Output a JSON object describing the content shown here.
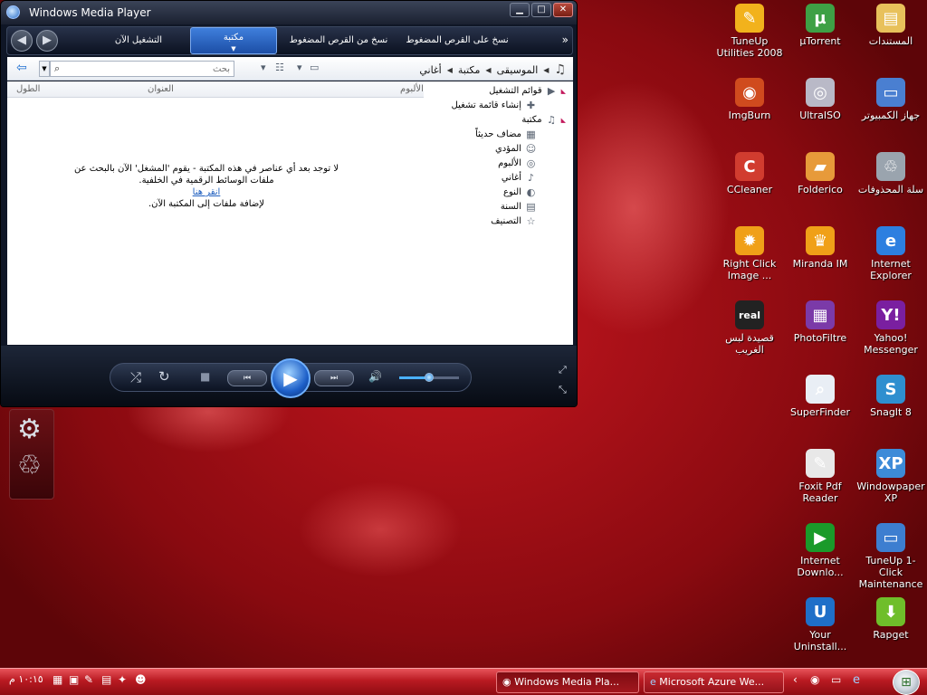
{
  "window": {
    "title": "Windows Media Player",
    "controls": {
      "minimize": "▁",
      "maximize": "□",
      "close": "✕"
    }
  },
  "nav": {
    "back": "◀",
    "forward": "▶",
    "tabs": {
      "now_playing": "التشغيل الآن",
      "library": "مكتبة",
      "rip": "نسخ من القرص المضغوط",
      "burn": "نسخ على القرص المضغوط"
    },
    "more": "»"
  },
  "toolbar": {
    "back_arrow": "⇦",
    "search_placeholder": "بحث",
    "breadcrumb": [
      "الموسيقى",
      "مكتبة",
      "أغاني"
    ]
  },
  "columns": {
    "length": "الطول",
    "title": "العنوان",
    "album": "الألبوم"
  },
  "empty_message": {
    "line1": "لا توجد بعد أي عناصر في هذه المكتبة - يقوم 'المشغل' الآن بالبحث عن",
    "line2": "ملفات الوسائط الرقمية في الخلفية.",
    "link": "انقر هنا",
    "line3": "لإضافة ملفات إلى المكتبة الآن."
  },
  "tree": [
    {
      "label": "قوائم التشغيل",
      "icon": "playlist-icon"
    },
    {
      "label": "إنشاء قائمة تشغيل",
      "icon": "create-playlist-icon"
    },
    {
      "label": "مكتبة",
      "icon": "library-music-icon"
    },
    {
      "label": "مضاف حديثاً",
      "icon": "recently-added-icon"
    },
    {
      "label": "المؤدي",
      "icon": "artist-icon"
    },
    {
      "label": "الألبوم",
      "icon": "album-icon"
    },
    {
      "label": "أغاني",
      "icon": "songs-icon"
    },
    {
      "label": "النوع",
      "icon": "genre-icon"
    },
    {
      "label": "السنة",
      "icon": "year-icon"
    },
    {
      "label": "التصنيف",
      "icon": "rating-icon"
    }
  ],
  "player": {
    "shuffle": "⤮",
    "repeat": "↻",
    "stop": "■",
    "prev": "⏮",
    "play": "▶",
    "next": "⏭",
    "volume_icon": "🔊",
    "volume_level": 0.5
  },
  "desktop_icons": [
    {
      "label": "TuneUp Utilities 2008",
      "glyph": "✎",
      "color": "#f2b21c"
    },
    {
      "label": "µTorrent",
      "glyph": "µ",
      "color": "#3ea045"
    },
    {
      "label": "المستندات",
      "glyph": "▤",
      "color": "#e8c15b"
    },
    {
      "label": "ImgBurn",
      "glyph": "◉",
      "color": "#d04b1e"
    },
    {
      "label": "UltraISO",
      "glyph": "◎",
      "color": "#b9b9c7"
    },
    {
      "label": "جهاز الكمبيوتر",
      "glyph": "▭",
      "color": "#4a7fd1"
    },
    {
      "label": "CCleaner",
      "glyph": "C",
      "color": "#d13c2f"
    },
    {
      "label": "Folderico",
      "glyph": "▰",
      "color": "#e79a3a"
    },
    {
      "label": "سلة المحذوفات",
      "glyph": "♲",
      "color": "#9aa4ae"
    },
    {
      "label": "Right Click Image ...",
      "glyph": "✹",
      "color": "#f0a018"
    },
    {
      "label": "Miranda IM",
      "glyph": "♛",
      "color": "#f0a018"
    },
    {
      "label": "Internet Explorer",
      "glyph": "e",
      "color": "#2d7fe0"
    },
    {
      "label": "قصيدة لبس الغريب",
      "glyph": "real",
      "color": "#222222"
    },
    {
      "label": "PhotoFiltre",
      "glyph": "▦",
      "color": "#7b3aa8"
    },
    {
      "label": "Yahoo! Messenger",
      "glyph": "Y!",
      "color": "#7a1fa0"
    },
    {
      "label": "SuperFinder",
      "glyph": "⌕",
      "color": "#e9eef5"
    },
    {
      "label": "SnagIt 8",
      "glyph": "S",
      "color": "#2f8fcf"
    },
    {
      "label": "Foxit Pdf Reader",
      "glyph": "✎",
      "color": "#e8e8e8"
    },
    {
      "label": "Windowpaper XP",
      "glyph": "XP",
      "color": "#3d8bd8"
    },
    {
      "label": "Internet Downlo...",
      "glyph": "▶",
      "color": "#1a9a2a"
    },
    {
      "label": "TuneUp 1-Click Maintenance",
      "glyph": "▭",
      "color": "#3d7ed0"
    },
    {
      "label": "Your Uninstall...",
      "glyph": "U",
      "color": "#1f6fc8"
    },
    {
      "label": "Rapget",
      "glyph": "⬇",
      "color": "#6fbe2a"
    }
  ],
  "taskbar": {
    "start_glyph": "⊞",
    "tasks": [
      "Windows Media Pla...",
      "Microsoft Azure We..."
    ],
    "clock": "١٠:١٥ م",
    "chevron": "‹"
  }
}
